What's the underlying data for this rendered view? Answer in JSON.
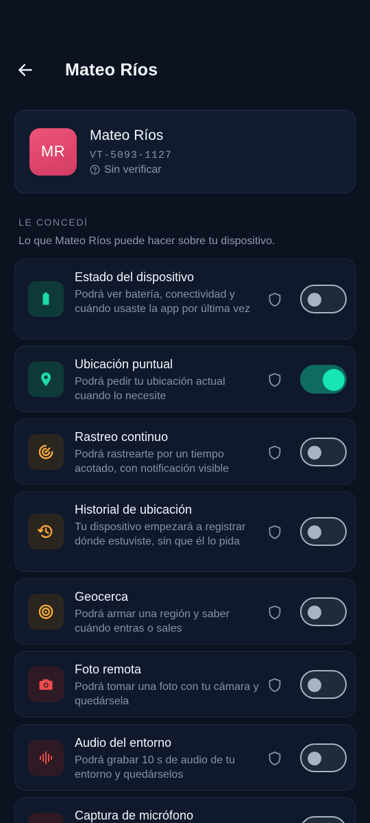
{
  "header": {
    "title": "Mateo Ríos"
  },
  "profile": {
    "initials": "MR",
    "name": "Mateo Ríos",
    "id": "VT-5093-1127",
    "status": "Sin verificar",
    "avatar_color": "#e34a70"
  },
  "section": {
    "title": "LE CONCEDÍ",
    "subtitle": "Lo que Mateo Ríos puede hacer sobre tu dispositivo."
  },
  "permissions": [
    {
      "title": "Estado del dispositivo",
      "desc": "Podrá ver batería, conectividad y cuándo usaste la app por última vez",
      "icon": "battery-icon",
      "enabled": false
    },
    {
      "title": "Ubicación puntual",
      "desc": "Podrá pedir tu ubicación actual cuando lo necesite",
      "icon": "location-pin-icon",
      "enabled": true
    },
    {
      "title": "Rastreo continuo",
      "desc": "Podrá rastrearte por un tiempo acotado, con notificación visible",
      "icon": "radar-icon",
      "enabled": false
    },
    {
      "title": "Historial de ubicación",
      "desc": "Tu dispositivo empezará a registrar dónde estuviste, sin que él lo pida",
      "icon": "history-icon",
      "enabled": false
    },
    {
      "title": "Geocerca",
      "desc": "Podrá armar una región y saber cuándo entras o sales",
      "icon": "geofence-icon",
      "enabled": false
    },
    {
      "title": "Foto remota",
      "desc": "Podrá tomar una foto con tu cámara y quedársela",
      "icon": "camera-icon",
      "enabled": false
    },
    {
      "title": "Audio del entorno",
      "desc": "Podrá grabar 10 s de audio de tu entorno y quedárselos",
      "icon": "audio-wave-icon",
      "enabled": false
    },
    {
      "title": "Captura de micrófono",
      "desc": "",
      "icon": "microphone-icon",
      "enabled": false
    }
  ],
  "colors": {
    "background": "#0b1220",
    "card": "#0f192b",
    "accent_on": "#18e5b4",
    "green_icon": "#1fd9a6",
    "amber_icon": "#f2a93b",
    "red_icon": "#ee4b4b"
  }
}
